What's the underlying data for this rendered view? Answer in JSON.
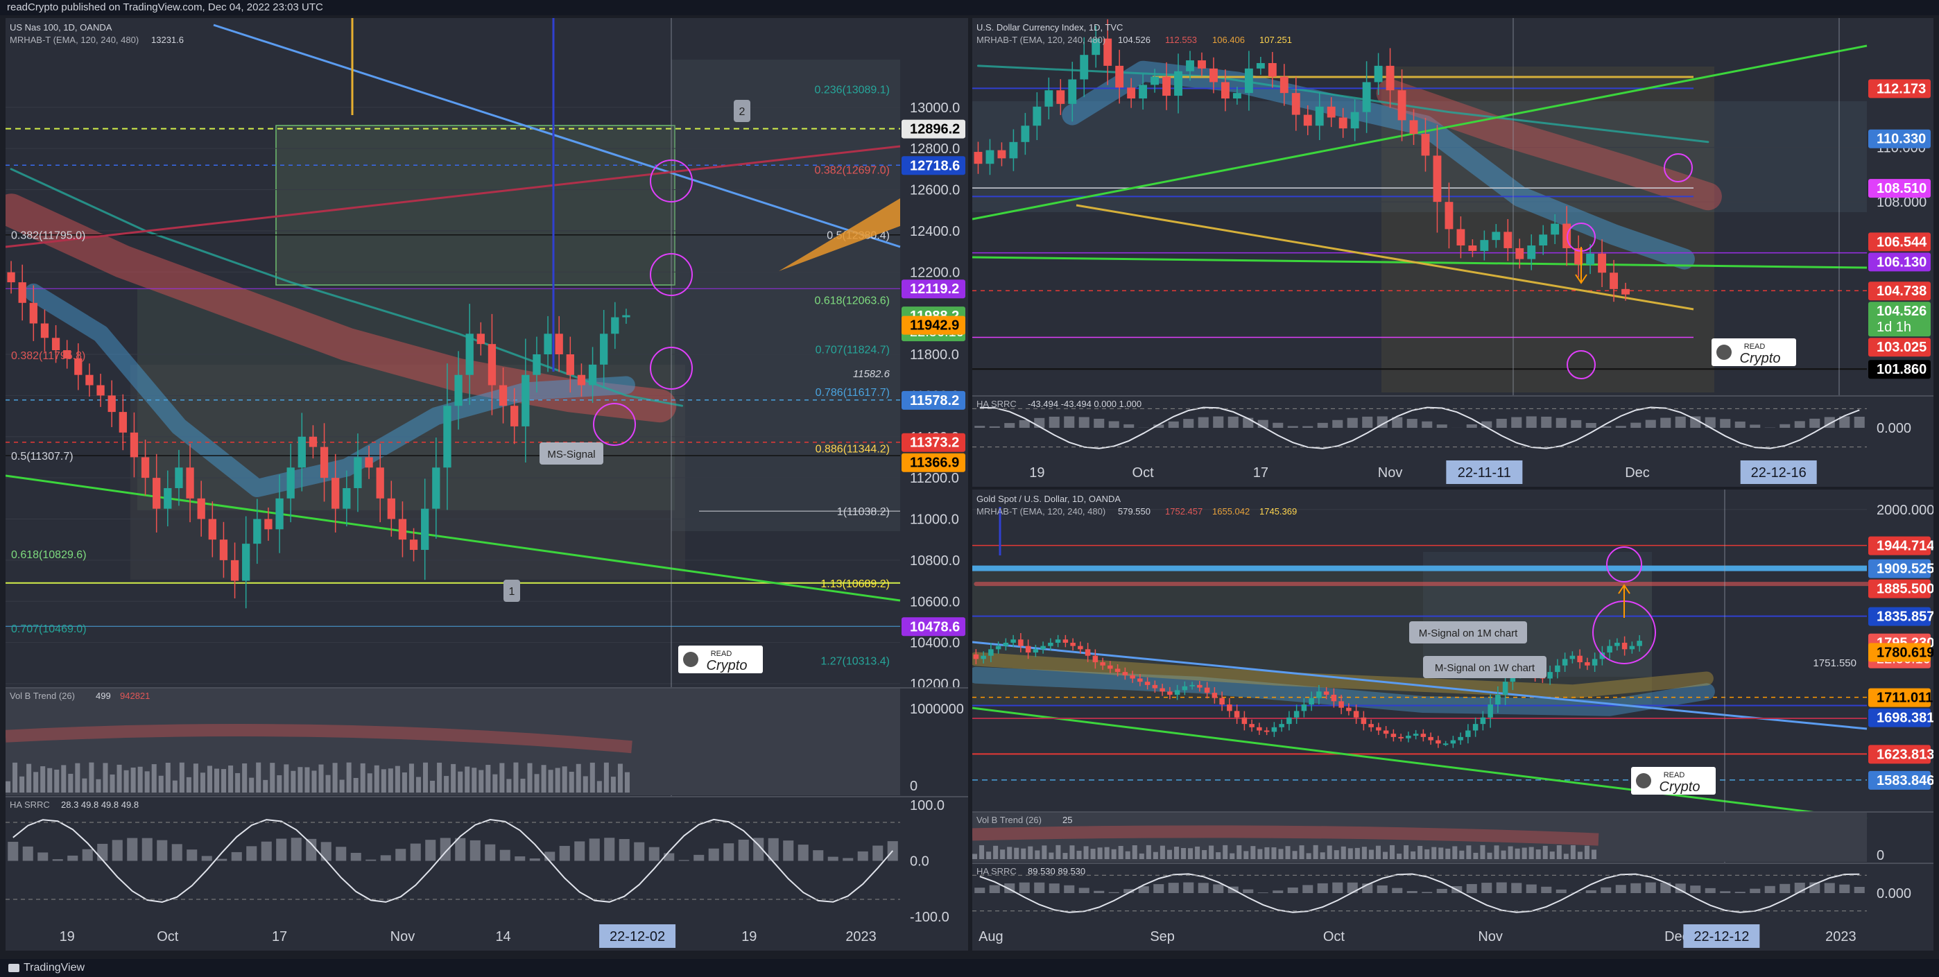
{
  "header": {
    "text": "readCrypto published on TradingView.com, Dec 04, 2022 23:03 UTC"
  },
  "footer": {
    "brand": "TradingView"
  },
  "watermark": {
    "line1": "READ",
    "line2": "Crypto"
  },
  "colors": {
    "bg": "#2a2e39",
    "bull": "#26a69a",
    "bear": "#ef5350",
    "green_line": "#3cd63c",
    "blue_line": "#5b9cf0",
    "red_ribbon": "#e05757",
    "blue_ribbon": "#4aa3df",
    "magenta": "#e040fb"
  },
  "chart_data": [
    {
      "id": "nas",
      "type": "candlestick",
      "title": "US Nas 100, 1D, OANDA",
      "indicator": "MRHAB-T (EMA, 120, 240, 480)",
      "indicator_value": "13231.6",
      "ylim": [
        10200,
        13400
      ],
      "yticks": [
        13000,
        12800,
        12600,
        12400,
        12200,
        11800,
        11600,
        11400,
        11200,
        11000,
        10800,
        10600,
        10400,
        10200
      ],
      "ytick_labels": [
        "13000.0",
        "12800.0",
        "12600.0",
        "12400.0",
        "12200.0",
        "11800.0",
        "11600.0",
        "11400.0",
        "11200.0",
        "11000.0",
        "10800.0",
        "10600.0",
        "10400.0",
        "10200.0"
      ],
      "xticks": [
        {
          "label": "19",
          "i": 5
        },
        {
          "label": "Oct",
          "i": 14
        },
        {
          "label": "17",
          "i": 24
        },
        {
          "label": "Nov",
          "i": 35
        },
        {
          "label": "14",
          "i": 44
        },
        {
          "label": "19",
          "i": 66
        },
        {
          "label": "2023",
          "i": 76
        }
      ],
      "x_highlight": {
        "label": "22-12-02",
        "i": 56
      },
      "n_slots": 80,
      "closes": [
        12150,
        12050,
        11950,
        11880,
        11820,
        11780,
        11700,
        11650,
        11600,
        11520,
        11420,
        11300,
        11200,
        11050,
        11150,
        11250,
        11100,
        11000,
        10900,
        10800,
        10700,
        10880,
        11000,
        10950,
        11100,
        11250,
        11400,
        11350,
        11200,
        11050,
        11150,
        11300,
        11250,
        11100,
        11000,
        10900,
        10850,
        11050,
        11250,
        11550,
        11700,
        11900,
        11850,
        11650,
        11550,
        11450,
        11700,
        11800,
        11900,
        11800,
        11700,
        11650,
        11750,
        11900,
        11980,
        11990
      ],
      "price_labels": [
        {
          "value": 12896.2,
          "text": "12896.2",
          "bg": "#e8e8e8",
          "fg": "#000000"
        },
        {
          "value": 12718.6,
          "text": "12718.6",
          "bg": "#1a48c8",
          "fg": "#ffffff"
        },
        {
          "value": 12119.2,
          "text": "12119.2",
          "bg": "#9a2ee8",
          "fg": "#ffffff"
        },
        {
          "value": 11988.2,
          "text": "11988.2",
          "bg": "#4caf50",
          "fg": "#ffffff",
          "sub": "22:56:10"
        },
        {
          "value": 11942.9,
          "text": "11942.9",
          "bg": "#ff9800",
          "fg": "#000000"
        },
        {
          "value": 11578.2,
          "text": "11578.2",
          "bg": "#3a7bd5",
          "fg": "#ffffff"
        },
        {
          "value": 11373.2,
          "text": "11373.2",
          "bg": "#e53935",
          "fg": "#ffffff"
        },
        {
          "value": 11366.9,
          "text": "11366.9",
          "bg": "#ff9800",
          "fg": "#000000"
        },
        {
          "value": 10478.6,
          "text": "10478.6",
          "bg": "#9a2ee8",
          "fg": "#ffffff"
        }
      ],
      "fib_labels": [
        {
          "value": 13089.1,
          "text": "0.236(13089.1)",
          "color": "#26a69a"
        },
        {
          "value": 12697.0,
          "text": "0.382(12697.0)",
          "color": "#e05757"
        },
        {
          "value": 12380.4,
          "text": "0.5(12380.4)",
          "color": "#d1d4dc"
        },
        {
          "value": 12063.6,
          "text": "0.618(12063.6)",
          "color": "#7fdc7f"
        },
        {
          "value": 11824.7,
          "text": "0.707(11824.7)",
          "color": "#26a69a"
        },
        {
          "value": 11617.7,
          "text": "0.786(11617.7)",
          "color": "#4aa3df"
        },
        {
          "value": 11344.2,
          "text": "0.886(11344.2)",
          "color": "#ffd54f"
        },
        {
          "value": 11038.2,
          "text": "1(11038.2)",
          "color": "#d1d4dc"
        },
        {
          "value": 10689.2,
          "text": "1.13(10689.2)",
          "color": "#ffeb3b"
        },
        {
          "value": 10313.4,
          "text": "1.27(10313.4)",
          "color": "#26a69a"
        }
      ],
      "left_fib_labels": [
        {
          "value": 12380.4,
          "text": "0.382(11795.0)",
          "color": "#d1d4dc"
        },
        {
          "value": 11795.8,
          "text": "0.382(11795.8)",
          "color": "#e05757"
        },
        {
          "value": 11307.7,
          "text": "0.5(11307.7)",
          "color": "#d1d4dc"
        },
        {
          "value": 10829.6,
          "text": "0.618(10829.6)",
          "color": "#7fdc7f"
        },
        {
          "value": 10469.0,
          "text": "0.707(10469.0)",
          "color": "#26a69a"
        }
      ],
      "annotations": [
        {
          "text": "2",
          "kind": "pin"
        },
        {
          "text": "1",
          "kind": "pin"
        },
        {
          "text": "MS-Signal",
          "kind": "callout"
        },
        {
          "text": "11582.6",
          "kind": "inline"
        }
      ],
      "sub1": {
        "title": "Vol B Trend (26)",
        "value": "499",
        "value2": "942821",
        "yticks": [
          "1000000",
          "0"
        ]
      },
      "sub2": {
        "title": "HA SRRC",
        "values": "28.3  49.8  49.8  49.8",
        "yticks": [
          "100.0",
          "0.0",
          "-100.0"
        ]
      }
    },
    {
      "id": "dxy",
      "type": "candlestick",
      "title": "U.S. Dollar Currency Index, 1D, TVC",
      "indicator": "MRHAB-T (EMA, 120, 240, 480)",
      "indicator_values": [
        "104.526",
        "112.553",
        "106.406",
        "107.251"
      ],
      "ylim": [
        101.0,
        114.5
      ],
      "yticks": [
        110.0,
        108.0
      ],
      "ytick_labels": [
        "110.000",
        "108.000"
      ],
      "xticks": [
        {
          "label": "19",
          "i": 5
        },
        {
          "label": "Oct",
          "i": 14
        },
        {
          "label": "17",
          "i": 24
        },
        {
          "label": "Nov",
          "i": 35
        },
        {
          "label": "Dec",
          "i": 56
        }
      ],
      "x_highlights": [
        {
          "label": "22-11-11",
          "i": 43
        },
        {
          "label": "22-12-16",
          "i": 68
        }
      ],
      "n_slots": 76,
      "closes": [
        109.4,
        109.9,
        109.6,
        110.2,
        110.8,
        111.5,
        112.1,
        111.6,
        112.5,
        113.4,
        114.0,
        113.0,
        112.2,
        111.8,
        112.3,
        112.6,
        111.9,
        112.8,
        113.2,
        112.9,
        112.4,
        111.8,
        112.0,
        112.9,
        113.1,
        112.6,
        112.0,
        111.2,
        110.8,
        111.5,
        111.1,
        110.7,
        111.3,
        112.4,
        113.0,
        112.1,
        111.0,
        110.5,
        109.7,
        108.0,
        107.0,
        106.4,
        106.2,
        106.6,
        106.9,
        106.3,
        105.9,
        106.4,
        106.8,
        107.2,
        106.3,
        105.7,
        106.1,
        105.4,
        104.8,
        104.6
      ],
      "price_labels": [
        {
          "value": 112.173,
          "text": "112.173",
          "bg": "#e53935",
          "fg": "#ffffff"
        },
        {
          "value": 110.33,
          "text": "110.330",
          "bg": "#3a7bd5",
          "fg": "#ffffff"
        },
        {
          "value": 108.51,
          "text": "108.510",
          "bg": "#e040fb",
          "fg": "#ffffff"
        },
        {
          "value": 106.544,
          "text": "106.544",
          "bg": "#e53935",
          "fg": "#ffffff"
        },
        {
          "value": 106.13,
          "text": "106.130",
          "bg": "#9a2ee8",
          "fg": "#ffffff"
        },
        {
          "value": 104.738,
          "text": "104.738",
          "bg": "#e53935",
          "fg": "#ffffff"
        },
        {
          "value": 104.526,
          "text": "104.526",
          "bg": "#4caf50",
          "fg": "#ffffff",
          "sub": "1d 1h"
        },
        {
          "value": 103.025,
          "text": "103.025",
          "bg": "#e53935",
          "fg": "#ffffff"
        },
        {
          "value": 101.86,
          "text": "101.860",
          "bg": "#000000",
          "fg": "#ffffff"
        }
      ],
      "sub1": {
        "title": "HA SRRC",
        "values": "-43.494  -43.494  0.000  1.000",
        "yticks": [
          "0.000"
        ]
      }
    },
    {
      "id": "gold",
      "type": "candlestick",
      "title": "Gold Spot / U.S. Dollar, 1D, OANDA",
      "indicator": "MRHAB-T (EMA, 120, 240, 480)",
      "indicator_values": [
        "579.550",
        "1752.457",
        "1655.042",
        "1745.369"
      ],
      "ylim": [
        1540,
        2020
      ],
      "yticks": [
        2000
      ],
      "ytick_labels": [
        "2000.000"
      ],
      "xticks": [
        {
          "label": "Aug",
          "i": 2
        },
        {
          "label": "Sep",
          "i": 25
        },
        {
          "label": "Oct",
          "i": 48
        },
        {
          "label": "Nov",
          "i": 69
        },
        {
          "label": "Dec",
          "i": 94
        },
        {
          "label": "2023",
          "i": 116
        }
      ],
      "x_highlight": {
        "label": "22-12-12",
        "i": 100
      },
      "n_slots": 120,
      "closes": [
        1770,
        1775,
        1785,
        1790,
        1795,
        1800,
        1790,
        1780,
        1785,
        1790,
        1795,
        1800,
        1795,
        1790,
        1785,
        1775,
        1765,
        1760,
        1755,
        1750,
        1745,
        1740,
        1735,
        1730,
        1725,
        1720,
        1715,
        1722,
        1728,
        1730,
        1726,
        1718,
        1710,
        1700,
        1690,
        1680,
        1670,
        1665,
        1660,
        1658,
        1665,
        1670,
        1680,
        1690,
        1700,
        1710,
        1720,
        1715,
        1705,
        1695,
        1690,
        1680,
        1670,
        1665,
        1660,
        1655,
        1650,
        1648,
        1652,
        1655,
        1650,
        1645,
        1640,
        1640,
        1645,
        1650,
        1660,
        1670,
        1680,
        1700,
        1715,
        1735,
        1750,
        1760,
        1755,
        1745,
        1740,
        1750,
        1760,
        1770,
        1775,
        1765,
        1760,
        1770,
        1780,
        1790,
        1795,
        1785,
        1790,
        1798
      ],
      "price_labels": [
        {
          "value": 1944.714,
          "text": "1944.714",
          "bg": "#e53935",
          "fg": "#ffffff"
        },
        {
          "value": 1909.525,
          "text": "1909.525",
          "bg": "#3a7bd5",
          "fg": "#ffffff"
        },
        {
          "value": 1885.5,
          "text": "1885.500",
          "bg": "#e53935",
          "fg": "#ffffff"
        },
        {
          "value": 1835.857,
          "text": "1835.857",
          "bg": "#1a48c8",
          "fg": "#ffffff"
        },
        {
          "value": 1795.23,
          "text": "1795.230",
          "bg": "#ef5350",
          "fg": "#ffffff",
          "sub": "22:56:10"
        },
        {
          "value": 1780.619,
          "text": "1780.619",
          "bg": "#ff9800",
          "fg": "#000000"
        },
        {
          "value": 1711.011,
          "text": "1711.011",
          "bg": "#ff9800",
          "fg": "#000000"
        },
        {
          "value": 1698.381,
          "text": "1698.381",
          "bg": "#1a48c8",
          "fg": "#ffffff"
        },
        {
          "value": 1623.813,
          "text": "1623.813",
          "bg": "#e53935",
          "fg": "#ffffff"
        },
        {
          "value": 1583.846,
          "text": "1583.846",
          "bg": "#3a7bd5",
          "fg": "#ffffff"
        }
      ],
      "annotations": [
        {
          "text": "M-Signal on 1M chart",
          "kind": "callout"
        },
        {
          "text": "M-Signal on 1W chart",
          "kind": "callout"
        },
        {
          "text": "1751.550",
          "kind": "inline"
        }
      ],
      "sub1": {
        "title": "Vol B Trend (26)",
        "value": "25",
        "yticks": [
          "0"
        ]
      },
      "sub2": {
        "title": "HA SRRC",
        "values": "89.530  89.530",
        "yticks": [
          "0.000"
        ]
      }
    }
  ]
}
